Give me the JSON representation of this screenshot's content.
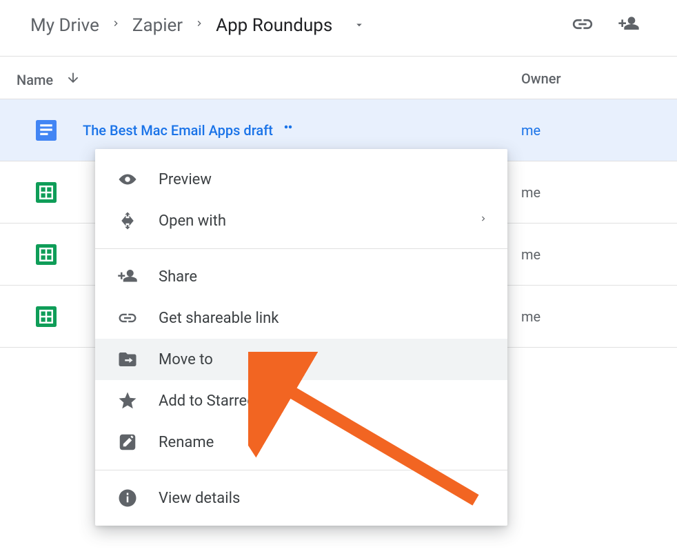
{
  "breadcrumb": {
    "root": "My Drive",
    "mid": "Zapier",
    "current": "App Roundups"
  },
  "columns": {
    "name": "Name",
    "owner": "Owner"
  },
  "files": {
    "row0": {
      "name": "The Best Mac Email Apps draft",
      "owner": "me"
    },
    "row1": {
      "name": "",
      "owner": "me"
    },
    "row2": {
      "name": "",
      "owner": "me"
    },
    "row3": {
      "name": "",
      "owner": "me"
    }
  },
  "menu": {
    "preview": "Preview",
    "openwith": "Open with",
    "share": "Share",
    "link": "Get shareable link",
    "moveto": "Move to",
    "starred": "Add to Starred",
    "rename": "Rename",
    "details": "View details"
  }
}
